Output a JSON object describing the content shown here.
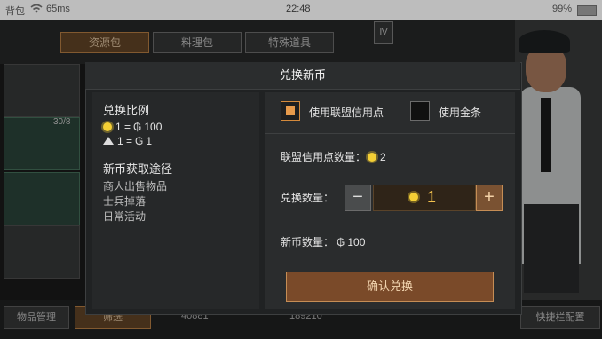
{
  "status_bar": {
    "carrier": "背包",
    "net_speed": "65ms",
    "time": "22:48",
    "battery": "99%"
  },
  "background": {
    "tabs": [
      "资源包",
      "料理包",
      "特殊道具"
    ],
    "card_count": "30/8",
    "manage_label": "物品管理",
    "filter_label": "筛选",
    "currency_a": "40881",
    "currency_b": "189210",
    "quick_slot_label": "快捷栏配置"
  },
  "modal": {
    "title": "兑换新币",
    "rate_title": "兑换比例",
    "rate_lines": [
      {
        "lhs": "1 =",
        "rhs": "100"
      },
      {
        "lhs": "1 =",
        "rhs": "1"
      }
    ],
    "source_title": "新币获取途径",
    "sources": [
      "商人出售物品",
      "士兵掉落",
      "日常活动"
    ],
    "option_alliance": "使用联盟信用点",
    "option_gold": "使用金条",
    "credit_label": "联盟信用点数量：",
    "credit_value": "2",
    "qty_label": "兑换数量：",
    "qty_value": "1",
    "new_coin_label": "新币数量：",
    "new_coin_value": "100",
    "confirm_label": "确认兑换"
  },
  "colors": {
    "accent": "#c58d55",
    "coin": "#f4cf35",
    "panel": "#202223"
  }
}
